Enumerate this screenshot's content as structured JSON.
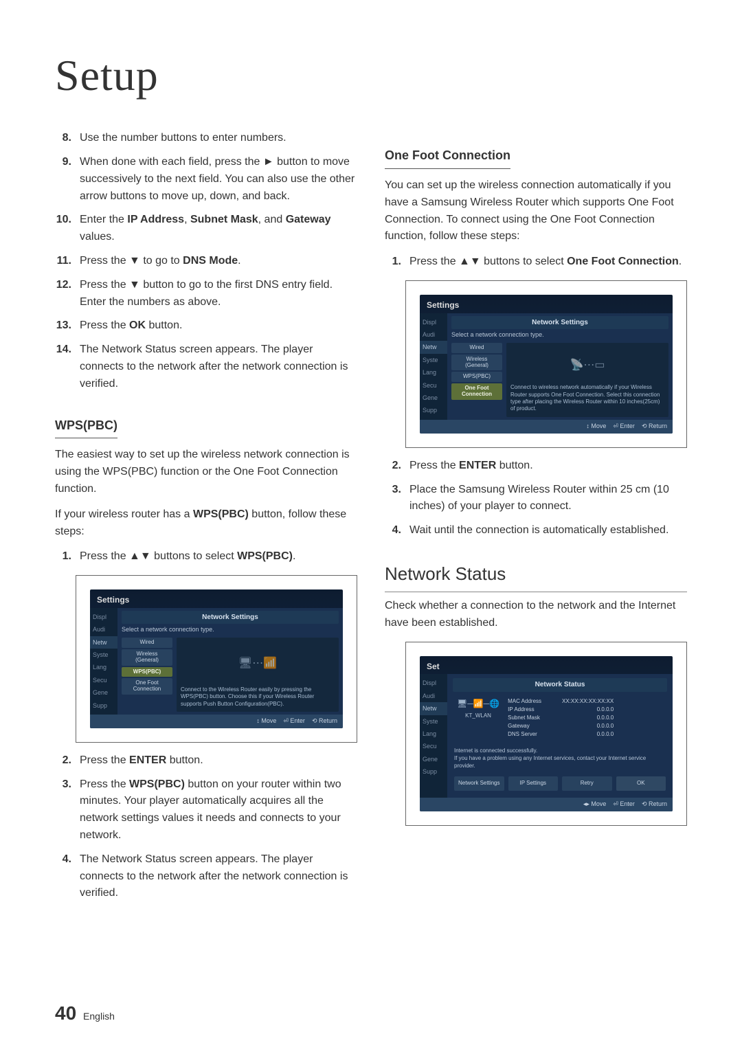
{
  "title": "Setup",
  "col1": {
    "list1": [
      {
        "n": "8.",
        "t": "Use the number buttons to enter numbers."
      },
      {
        "n": "9.",
        "t_parts": [
          "When done with each field, press the ► button to move successively to the next field. You can also use the other arrow buttons to move up, down, and back."
        ]
      },
      {
        "n": "10.",
        "t_parts": [
          "Enter the ",
          {
            "b": "IP Address"
          },
          ", ",
          {
            "b": "Subnet Mask"
          },
          ", and ",
          {
            "b": "Gateway"
          },
          " values."
        ]
      },
      {
        "n": "11.",
        "t_parts": [
          "Press the ▼ to go to ",
          {
            "b": "DNS Mode"
          },
          "."
        ]
      },
      {
        "n": "12.",
        "t": "Press the ▼ button to go to the first DNS entry field. Enter the numbers as above."
      },
      {
        "n": "13.",
        "t_parts": [
          "Press the ",
          {
            "b": "OK"
          },
          " button."
        ]
      },
      {
        "n": "14.",
        "t": "The Network Status screen appears. The player connects to the network after the network connection is verified."
      }
    ],
    "wps_heading": "WPS(PBC)",
    "wps_para1": "The easiest way to set up the wireless network connection is using the WPS(PBC) function or the One Foot Connection function.",
    "wps_para2_parts": [
      "If your wireless router has a ",
      {
        "b": "WPS(PBC)"
      },
      " button, follow these steps:"
    ],
    "wps_steps1": [
      {
        "n": "1.",
        "t_parts": [
          "Press the ▲▼ buttons to select ",
          {
            "b": "WPS(PBC)"
          },
          "."
        ]
      }
    ],
    "wps_steps2": [
      {
        "n": "2.",
        "t_parts": [
          "Press the ",
          {
            "b": "ENTER"
          },
          " button."
        ]
      },
      {
        "n": "3.",
        "t_parts": [
          "Press the ",
          {
            "b": "WPS(PBC)"
          },
          " button on your router within two minutes. Your player automatically acquires all the network settings values it needs and connects to your network."
        ]
      },
      {
        "n": "4.",
        "t": "The Network Status screen appears. The player connects to the network after the network connection is verified."
      }
    ]
  },
  "col2": {
    "ofc_heading": "One Foot Connection",
    "ofc_para": "You can set up the wireless connection automatically if you have a Samsung Wireless Router which supports One Foot Connection. To connect using the One Foot Connection function, follow these steps:",
    "ofc_steps1": [
      {
        "n": "1.",
        "t_parts": [
          "Press the ▲▼ buttons to select ",
          {
            "b": "One Foot Connection"
          },
          "."
        ]
      }
    ],
    "ofc_steps2": [
      {
        "n": "2.",
        "t_parts": [
          "Press the ",
          {
            "b": "ENTER"
          },
          " button."
        ]
      },
      {
        "n": "3.",
        "t": "Place the Samsung Wireless Router within 25 cm (10 inches) of your player to connect."
      },
      {
        "n": "4.",
        "t": "Wait until the connection is automatically established."
      }
    ],
    "ns_heading": "Network Status",
    "ns_para": "Check whether a connection to the network and the Internet have been established."
  },
  "screenshot1": {
    "settings": "Settings",
    "header": "Network Settings",
    "instr": "Select a network connection type.",
    "sidebar": [
      "Displ",
      "Audi",
      "Netw",
      "Syste",
      "Lang",
      "Secu",
      "Gene",
      "Supp"
    ],
    "options": [
      "Wired",
      "Wireless\n(General)",
      "WPS(PBC)",
      "One Foot\nConnection"
    ],
    "selected": 2,
    "detail": "Connect to the Wireless Router easily by pressing the WPS(PBC) button. Choose this if your Wireless Router supports Push Button Configuration(PBC).",
    "footer": [
      "↕ Move",
      "⏎ Enter",
      "⟲ Return"
    ]
  },
  "screenshot2": {
    "settings": "Settings",
    "header": "Network Settings",
    "instr": "Select a network connection type.",
    "sidebar": [
      "Displ",
      "Audi",
      "Netw",
      "Syste",
      "Lang",
      "Secu",
      "Gene",
      "Supp"
    ],
    "options": [
      "Wired",
      "Wireless\n(General)",
      "WPS(PBC)",
      "One Foot\nConnection"
    ],
    "selected": 3,
    "detail": "Connect to wireless network automatically if your Wireless Router supports One Foot Connection. Select this connection type after placing the Wireless Router within 10 inches(25cm) of product.",
    "footer": [
      "↕ Move",
      "⏎ Enter",
      "⟲ Return"
    ]
  },
  "screenshot3": {
    "settings_partial": "Set",
    "header": "Network Status",
    "sidebar": [
      "Displ",
      "Audi",
      "Netw",
      "Syste",
      "Lang",
      "Secu",
      "Gene",
      "Supp"
    ],
    "wlan": "KT_WLAN",
    "table": [
      [
        "MAC Address",
        "XX:XX:XX:XX:XX:XX"
      ],
      [
        "IP Address",
        "0.0.0.0"
      ],
      [
        "Subnet Mask",
        "0.0.0.0"
      ],
      [
        "Gateway",
        "0.0.0.0"
      ],
      [
        "DNS Server",
        "0.0.0.0"
      ]
    ],
    "msg": "Internet is connected successfully.\nIf you have a problem using any Internet services, contact your Internet service provider.",
    "buttons": [
      "Network Settings",
      "IP Settings",
      "Retry",
      "OK"
    ],
    "footer": [
      "◂▸ Move",
      "⏎ Enter",
      "⟲ Return"
    ]
  },
  "page_number": "40",
  "page_lang": "English"
}
